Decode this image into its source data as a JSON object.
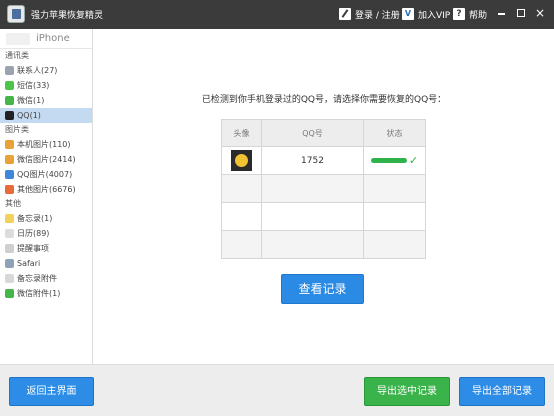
{
  "window": {
    "title": "强力苹果恢复精灵",
    "login_register": "登录 / 注册",
    "join_vip": "加入VIP",
    "vip_icon_text": "V",
    "help": "帮助",
    "help_icon_text": "?",
    "close_glyph": "×"
  },
  "sidebar": {
    "device": "iPhone",
    "groups": [
      {
        "label": "通讯类",
        "items": [
          {
            "label": "联系人(27)",
            "icon": "contacts-icon",
            "color": "#9aa4b0"
          },
          {
            "label": "短信(33)",
            "icon": "sms-icon",
            "color": "#4cc44c"
          },
          {
            "label": "微信(1)",
            "icon": "wechat-icon",
            "color": "#44b549"
          },
          {
            "label": "QQ(1)",
            "icon": "qq-icon",
            "color": "#222222",
            "active": true
          }
        ]
      },
      {
        "label": "图片类",
        "items": [
          {
            "label": "本机图片(110)",
            "icon": "photos-icon",
            "color": "#e8a23a"
          },
          {
            "label": "微信图片(2414)",
            "icon": "wechat-photos-icon",
            "color": "#e8a23a"
          },
          {
            "label": "QQ图片(4007)",
            "icon": "qq-photos-icon",
            "color": "#3f87d9"
          },
          {
            "label": "其他图片(6676)",
            "icon": "other-photos-icon",
            "color": "#e86a3a"
          }
        ]
      },
      {
        "label": "其他",
        "items": [
          {
            "label": "备忘录(1)",
            "icon": "notes-icon",
            "color": "#f2d25a"
          },
          {
            "label": "日历(89)",
            "icon": "calendar-icon",
            "color": "#dcdcdc"
          },
          {
            "label": "提醒事项",
            "icon": "reminders-icon",
            "color": "#cfcfcf"
          },
          {
            "label": "Safari",
            "icon": "safari-icon",
            "color": "#8fa3b8"
          },
          {
            "label": "备忘录附件",
            "icon": "notes-attachment-icon",
            "color": "#d8d8d8"
          },
          {
            "label": "微信附件(1)",
            "icon": "wechat-attachment-icon",
            "color": "#44b549"
          }
        ]
      }
    ]
  },
  "main": {
    "prompt": "已检测到你手机登录过的QQ号，请选择你需要恢复的QQ号：",
    "table": {
      "headers": [
        "头像",
        "QQ号",
        "状态"
      ],
      "rows": [
        {
          "qq": "1752",
          "status_check": "✓",
          "status_progress": 1.0
        }
      ]
    },
    "view_button": "查看记录"
  },
  "bottombar": {
    "back": "返回主界面",
    "export_selected": "导出选中记录",
    "export_all": "导出全部记录"
  },
  "colors": {
    "accent_blue": "#2d8ce6",
    "accent_green": "#3ab34a",
    "titlebar": "#3b3b3b",
    "active_row": "#c4daf0"
  }
}
